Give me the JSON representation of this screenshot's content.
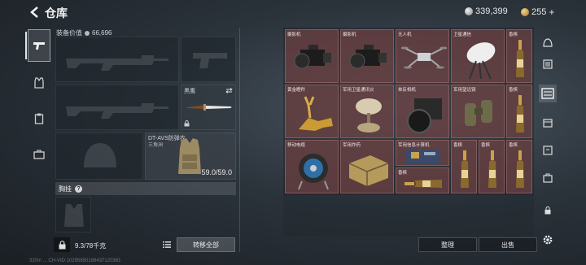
{
  "header": {
    "title": "仓库",
    "silver_amount": "339,399",
    "gold_amount": "255",
    "plus_symbol": "+"
  },
  "equipment": {
    "value_label": "装备价值",
    "value_amount": "66,696",
    "melee_label": "黑鹰",
    "armor_name": "DT-AVS防弹衣",
    "armor_class": "三角洲",
    "armor_durability": "59.0/59.0"
  },
  "chest_rig": {
    "label": "胸挂",
    "help": "?"
  },
  "bottom_left": {
    "capacity": "9.3/78千克",
    "transfer_all": "转移全部"
  },
  "storage": {
    "items": [
      {
        "label": "摄影机"
      },
      {
        "label": "摄影机"
      },
      {
        "label": "无人机"
      },
      {
        "label": "卫星通信"
      },
      {
        "label": "香槟"
      },
      {
        "label": "黄金瞪羚"
      },
      {
        "label": "军用卫星通讯仪"
      },
      {
        "label": "单反相机"
      },
      {
        "label": "军用望远镜"
      },
      {
        "label": "香槟"
      },
      {
        "label": "移动电缆"
      },
      {
        "label": "军用炸药"
      },
      {
        "label": "军用信息计算机"
      },
      {
        "label": "香槟"
      },
      {
        "label": "香槟"
      },
      {
        "label": "香槟"
      },
      {
        "label": "香槟"
      }
    ],
    "sort_label": "整理",
    "sell_label": "出售"
  },
  "footer": {
    "text": "320m ... CH-VID:10295850188437120381"
  },
  "colors": {
    "item_bg": "#7d4646",
    "accent": "#dfe6ea"
  }
}
